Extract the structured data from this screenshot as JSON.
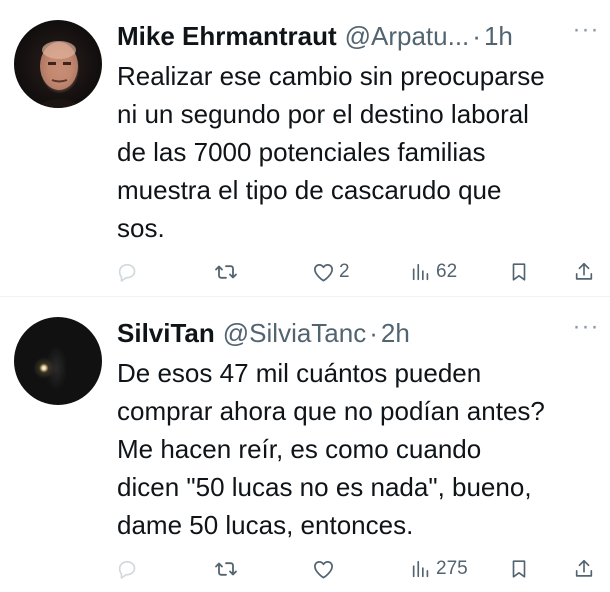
{
  "tweets": [
    {
      "name": "Mike Ehrmantraut",
      "handle": "@Arpatu...",
      "separator": "·",
      "time": "1h",
      "more": "···",
      "text": "Realizar ese cambio sin preocuparse\nni un segundo por el destino  laboral\nde las 7000 potenciales  familias\nmuestra el tipo de cascarudo que\nsos.",
      "likes": "2",
      "views": "62"
    },
    {
      "name": "SilviTan",
      "handle": "@SilviaTanc",
      "separator": "·",
      "time": "2h",
      "more": "···",
      "text": "De esos 47 mil cuántos pueden\ncomprar ahora que no podían antes?\nMe hacen reír, es como cuando\ndicen \"50 lucas no es nada\", bueno,\ndame 50 lucas, entonces.",
      "likes": "",
      "views": "275"
    }
  ],
  "icons": {
    "reply": "reply-icon",
    "retweet": "retweet-icon",
    "like": "heart-icon",
    "views": "views-icon",
    "bookmark": "bookmark-icon",
    "share": "share-icon",
    "more": "more-icon"
  },
  "colors": {
    "text": "#0f1419",
    "secondary": "#536471",
    "faint_icon": "#cfd9de",
    "divider": "#eff3f4"
  }
}
